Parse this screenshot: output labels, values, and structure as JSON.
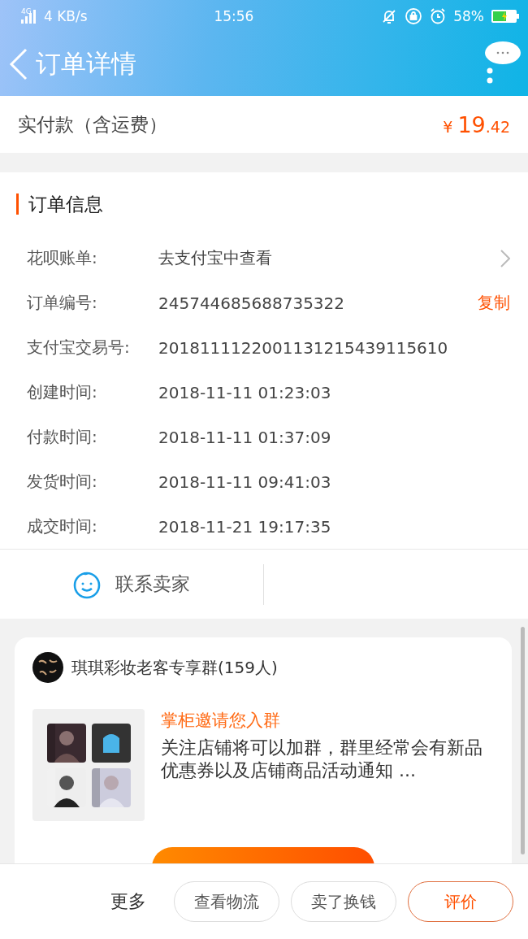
{
  "status_bar": {
    "network": "4G",
    "speed": "4 KB/s",
    "time": "15:56",
    "battery": "58%"
  },
  "header": {
    "title": "订单详情"
  },
  "payment": {
    "label": "实付款（含运费）",
    "currency": "¥",
    "amount": "19",
    "decimals": ".42"
  },
  "order_info": {
    "title": "订单信息",
    "rows": [
      {
        "kind": "link",
        "label": "花呗账单:",
        "value": "去支付宝中查看"
      },
      {
        "kind": "copy",
        "label": "订单编号:",
        "value": "245744685688735322",
        "action": "复制"
      },
      {
        "kind": "plain",
        "label": "支付宝交易号:",
        "value": "2018111122001131215439115610"
      },
      {
        "kind": "plain",
        "label": "创建时间:",
        "value": "2018-11-11 01:23:03"
      },
      {
        "kind": "plain",
        "label": "付款时间:",
        "value": "2018-11-11 01:37:09"
      },
      {
        "kind": "plain",
        "label": "发货时间:",
        "value": "2018-11-11 09:41:03"
      },
      {
        "kind": "plain",
        "label": "成交时间:",
        "value": "2018-11-21 19:17:35"
      }
    ]
  },
  "contact": {
    "label": "联系卖家"
  },
  "group": {
    "name": "琪琪彩妆老客专享群(159人)",
    "invite_title": "掌柜邀请您入群",
    "invite_text": "关注店铺将可以加群，群里经常会有新品优惠券以及店铺商品活动通知 ..."
  },
  "bottom_bar": {
    "more": "更多",
    "buttons": [
      {
        "kind": "outline",
        "label": "查看物流"
      },
      {
        "kind": "outline",
        "label": "卖了换钱"
      },
      {
        "kind": "primary",
        "label": "评价"
      }
    ]
  }
}
